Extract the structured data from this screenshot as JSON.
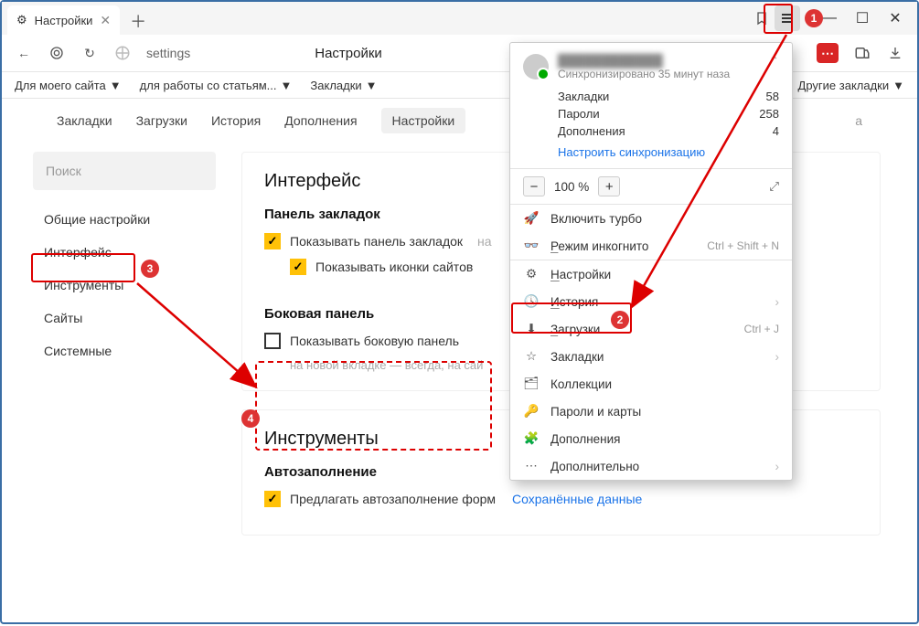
{
  "tab": {
    "title": "Настройки"
  },
  "nav": {
    "addr": "settings",
    "title": "Настройки"
  },
  "bookmarkbar": {
    "items": [
      "Для моего сайта",
      "для работы со статьям...",
      "Закладки"
    ],
    "right": "Другие закладки"
  },
  "section_tabs": [
    "Закладки",
    "Загрузки",
    "История",
    "Дополнения",
    "Настройки",
    "а"
  ],
  "sidebar": {
    "search": "Поиск",
    "items": [
      "Общие настройки",
      "Интерфейс",
      "Инструменты",
      "Сайты",
      "Системные"
    ]
  },
  "panels": {
    "interface": {
      "title": "Интерфейс",
      "bookmarks_panel": {
        "heading": "Панель закладок",
        "show_panel": "Показывать панель закладок",
        "panel_suffix": "на",
        "show_icons": "Показывать иконки сайтов"
      },
      "side_panel": {
        "heading": "Боковая панель",
        "show_side": "Показывать боковую панель",
        "hint": "на новой вкладке — всегда, на сай"
      }
    },
    "tools": {
      "title": "Инструменты",
      "autofill": {
        "heading": "Автозаполнение",
        "suggest": "Предлагать автозаполнение форм",
        "saved": "Сохранённые данные"
      }
    }
  },
  "menu": {
    "user_hidden": "████████████",
    "sync_status": "Синхронизировано 35 минут наза",
    "stats": {
      "bookmarks_label": "Закладки",
      "bookmarks": "58",
      "passwords_label": "Пароли",
      "passwords": "258",
      "addons_label": "Дополнения",
      "addons": "4"
    },
    "sync_link": "Настроить синхронизацию",
    "zoom": "100 %",
    "items": {
      "turbo": "Включить турбо",
      "incognito": "Режим инкогнито",
      "incognito_sc": "Ctrl + Shift + N",
      "settings": "Настройки",
      "history": "История",
      "downloads": "Загрузки",
      "downloads_sc": "Ctrl + J",
      "bookmarks": "Закладки",
      "collections": "Коллекции",
      "passwords": "Пароли и карты",
      "addons": "Дополнения",
      "more": "Дополнительно"
    }
  }
}
